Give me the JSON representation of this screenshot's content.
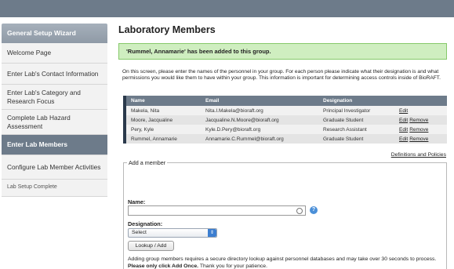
{
  "sidebar": {
    "header": "General Setup Wizard",
    "items": [
      {
        "label": "Welcome Page"
      },
      {
        "label": "Enter Lab's Contact Information"
      },
      {
        "label": "Enter Lab's Category and Research Focus"
      },
      {
        "label": "Complete Lab Hazard Assessment"
      },
      {
        "label": "Enter Lab Members"
      },
      {
        "label": "Configure Lab Member Activities"
      },
      {
        "label": "Lab Setup Complete"
      }
    ]
  },
  "main": {
    "title": "Laboratory Members",
    "alert": "'Rummel, Annamarie' has been added to this group.",
    "intro": "On this screen, please enter the names of the personnel in your group. For each person please indicate what their designation is and what permissions you would like them to have within your group. This information is important for determining access controls inside of BioRAFT.",
    "table": {
      "headers": {
        "name": "Name",
        "email": "Email",
        "designation": "Designation"
      },
      "rows": [
        {
          "name": "Makela, Nita",
          "email": "Nita.I.Makela@bioraft.org",
          "designation": "Principal Investigator",
          "edit": "Edit"
        },
        {
          "name": "Moore, Jacqualine",
          "email": "Jacqualine.N.Moore@bioraft.org",
          "designation": "Graduate Student",
          "edit": "Edit",
          "remove": "Remove"
        },
        {
          "name": "Pery, Kyle",
          "email": "Kyle.D.Pery@bioraft.org",
          "designation": "Research Assistant",
          "edit": "Edit",
          "remove": "Remove"
        },
        {
          "name": "Rummel, Annamarie",
          "email": "Annamarie.C.Rummel@bioraft.org",
          "designation": "Graduate Student",
          "edit": "Edit",
          "remove": "Remove"
        }
      ]
    },
    "definitions_link": "Definitions and Policies",
    "add_member": {
      "legend": "Add a member",
      "name_label": "Name:",
      "name_value": "",
      "designation_label": "Designation:",
      "designation_value": "Select",
      "button": "Lookup / Add",
      "note_part1": "Adding group members requires a secure directory lookup against personnel databases and may take over 30 seconds to process.",
      "note_bold": "Please only click Add Once.",
      "note_part2": "Thank you for your patience."
    }
  }
}
